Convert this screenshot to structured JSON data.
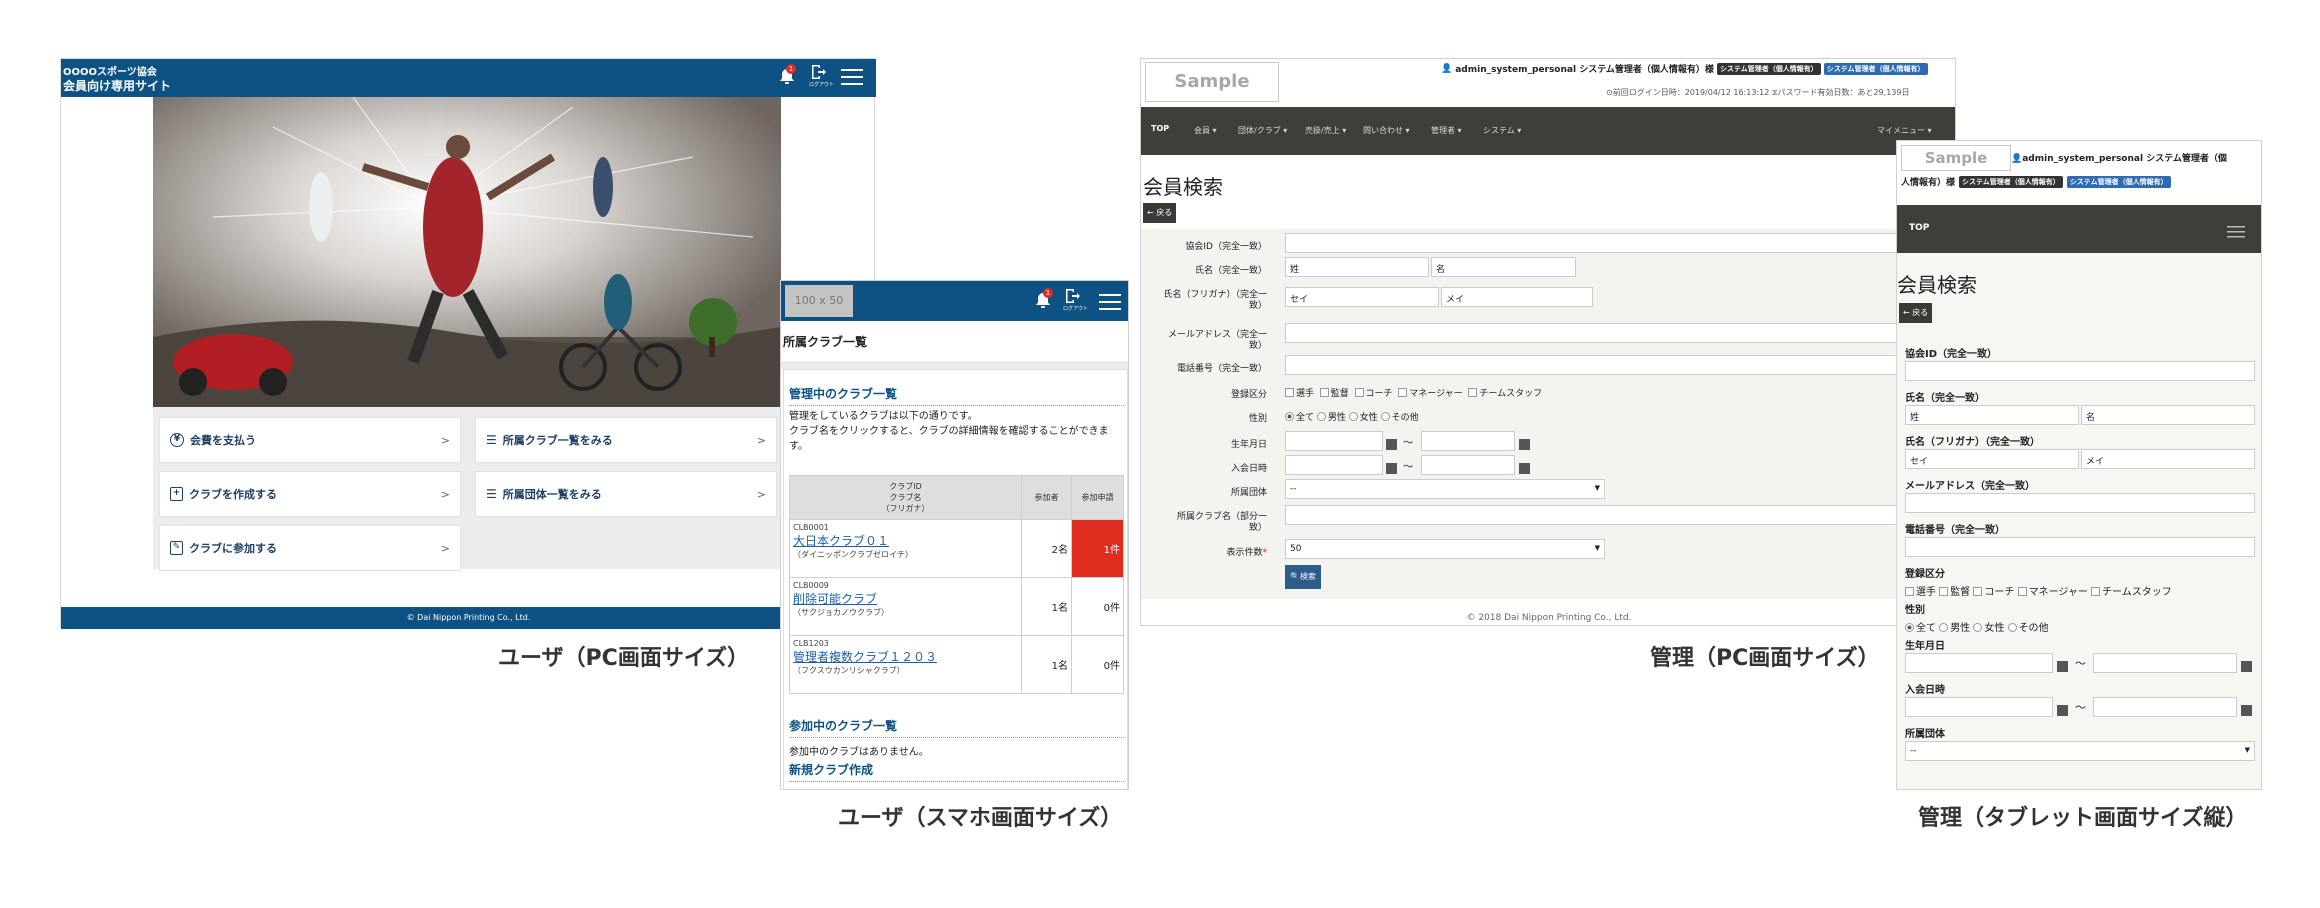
{
  "user_pc": {
    "site_line1": "OOOOスポーツ協会",
    "site_line2": "会員向け専用サイト",
    "notif_count": "1",
    "logout_label": "ログアウト",
    "menu": [
      {
        "label": "会費を支払う"
      },
      {
        "label": "所属クラブ一覧をみる"
      },
      {
        "label": "クラブを作成する"
      },
      {
        "label": "所属団体一覧をみる"
      },
      {
        "label": "クラブに参加する"
      }
    ],
    "chevron": ">",
    "footer": "© Dai Nippon Printing Co., Ltd.",
    "caption": "ユーザ（PC画面サイズ）"
  },
  "user_sp": {
    "logo": "100 x 50",
    "notif_count": "1",
    "logout_label": "ログアウト",
    "page_title": "所属クラブ一覧",
    "managed_title": "管理中のクラブ一覧",
    "managed_desc1": "管理をしているクラブは以下の通りです。",
    "managed_desc2": "クラブ名をクリックすると、クラブの詳細情報を確認することができます。",
    "table_headers": {
      "col1a": "クラブID",
      "col1b": "クラブ名",
      "col1c": "（フリガナ）",
      "col2": "参加者",
      "col3": "参加申請"
    },
    "rows": [
      {
        "id": "CLB0001",
        "name": "大日本クラブ０１",
        "kana": "（ダイニッポンクラブゼロイチ）",
        "members": "2名",
        "requests": "1件"
      },
      {
        "id": "CLB0009",
        "name": "削除可能クラブ",
        "kana": "（サクジョカノウクラブ）",
        "members": "1名",
        "requests": "0件"
      },
      {
        "id": "CLB1203",
        "name": "管理者複数クラブ１２０３",
        "kana": "（フクスウカンリシャクラブ）",
        "members": "1名",
        "requests": "0件"
      }
    ],
    "joined_title": "参加中のクラブ一覧",
    "joined_empty": "参加中のクラブはありません。",
    "new_club": "新規クラブ作成",
    "caption": "ユーザ（スマホ画面サイズ）"
  },
  "admin_pc": {
    "logo": "Sample",
    "user_name": "admin_system_personal システム管理者（個人情報有）様",
    "badge1": "システム管理者（個人情報有）",
    "badge2": "システム管理者（個人情報有）",
    "login_info": "前回ログイン日時：2019/04/12 16:13:12",
    "password_info": "パスワード有効日数：あと29,139日",
    "nav": [
      "TOP",
      "会員 ▾",
      "団体/クラブ ▾",
      "売掛/売上 ▾",
      "問い合わせ ▾",
      "管理者 ▾",
      "システム ▾"
    ],
    "my_menu": "マイメニュー ▾",
    "page_title": "会員検索",
    "back_label": "← 戻る",
    "fields": {
      "assoc_id": "協会ID（完全一致）",
      "name": "氏名（完全一致）",
      "name_sei": "姓",
      "name_mei": "名",
      "kana_l1": "氏名（フリガナ）（完全一",
      "kana_l2": "致）",
      "kana_sei": "セイ",
      "kana_mei": "メイ",
      "email_l1": "メールアドレス（完全一",
      "email_l2": "致）",
      "phone": "電話番号（完全一致）",
      "reg_type": "登録区分",
      "gender": "性別",
      "birthdate": "生年月日",
      "joined": "入会日時",
      "org": "所属団体",
      "club_l1": "所属クラブ名（部分一",
      "club_l2": "致）",
      "per_page": "表示件数",
      "required_mark": "*"
    },
    "reg_options": [
      "選手",
      "監督",
      "コーチ",
      "マネージャー",
      "チームスタッフ"
    ],
    "gender_options": [
      "全て",
      "男性",
      "女性",
      "その他"
    ],
    "gender_selected": "全て",
    "tilde": "〜",
    "org_value": "--",
    "per_page_value": "50",
    "search_label": "検索",
    "footer": "© 2018 Dai Nippon Printing Co., Ltd.",
    "caption": "管理（PC画面サイズ）"
  },
  "admin_tablet": {
    "logo": "Sample",
    "user_name": "admin_system_personal システム管理者（個",
    "user_name2": "人情報有）様",
    "badge1": "システム管理者（個人情報有）",
    "badge2": "システム管理者（個人情報有）",
    "nav_top": "TOP",
    "page_title": "会員検索",
    "back_label": "← 戻る",
    "assoc_id": "協会ID（完全一致）",
    "name": "氏名（完全一致）",
    "name_sei": "姓",
    "name_mei": "名",
    "kana": "氏名（フリガナ）（完全一致）",
    "kana_sei": "セイ",
    "kana_mei": "メイ",
    "email": "メールアドレス（完全一致）",
    "phone": "電話番号（完全一致）",
    "reg_type": "登録区分",
    "reg_options": [
      "選手",
      "監督",
      "コーチ",
      "マネージャー",
      "チームスタッフ"
    ],
    "gender": "性別",
    "gender_options": [
      "全て",
      "男性",
      "女性",
      "その他"
    ],
    "birthdate": "生年月日",
    "joined": "入会日時",
    "org": "所属団体",
    "org_value": "--",
    "tilde": "〜",
    "caption": "管理（タブレット画面サイズ縦）"
  },
  "colors": {
    "brand_blue": "#0d5283",
    "dark_nav": "#3f3f3a",
    "alert_red": "#e02b1f"
  }
}
